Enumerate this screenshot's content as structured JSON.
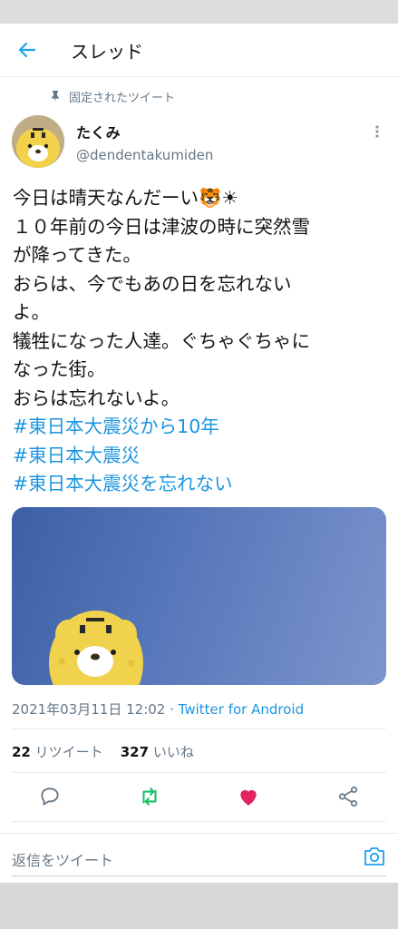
{
  "header": {
    "title": "スレッド"
  },
  "tweet": {
    "pinned_label": "固定されたツイート",
    "author_name": "たくみ",
    "author_handle": "@dendentakumiden",
    "text_lines": [
      "今日は晴天なんだーい🐯☀",
      "１０年前の今日は津波の時に突然雪",
      "が降ってきた。",
      "おらは、今でもあの日を忘れない",
      "よ。",
      "犠牲になった人達。ぐちゃぐちゃに",
      "なった街。",
      "おらは忘れないよ。"
    ],
    "hashtags": [
      "#東日本大震災から10年",
      "#東日本大震災",
      "#東日本大震災を忘れない"
    ],
    "timestamp": "2021年03月11日 12:02",
    "separator": " · ",
    "client": "Twitter for Android",
    "retweet_count": "22",
    "retweet_label": "リツイート",
    "like_count": "327",
    "like_label": "いいね"
  },
  "reply": {
    "placeholder": "返信をツイート"
  },
  "colors": {
    "accent": "#1da1f2",
    "retweet": "#17bf63",
    "like": "#e0245e",
    "secondary_text": "#657786"
  },
  "icons": [
    "back-arrow-icon",
    "pin-icon",
    "more-vertical-icon",
    "reply-icon",
    "retweet-icon",
    "heart-icon",
    "share-icon",
    "camera-icon"
  ]
}
